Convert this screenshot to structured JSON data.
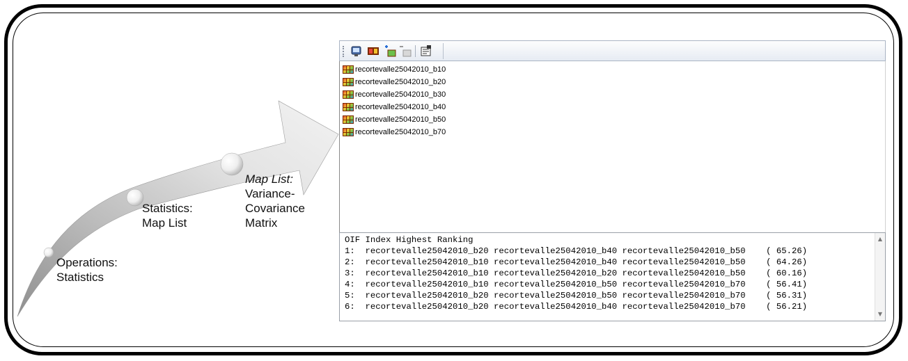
{
  "steps": [
    {
      "line1": "Operations:",
      "line2": "Statistics"
    },
    {
      "line1": "Statistics:",
      "line2": "Map List"
    },
    {
      "line1_italic": "Map List:",
      "line2": "Variance-",
      "line3": "Covariance",
      "line4": "Matrix"
    }
  ],
  "toolbar": {
    "buttons": [
      "display-icon",
      "film-strip-icon",
      "new-map-icon",
      "delete-map-icon",
      "properties-icon"
    ]
  },
  "maplist": {
    "items": [
      "recortevalle25042010_b10",
      "recortevalle25042010_b20",
      "recortevalle25042010_b30",
      "recortevalle25042010_b40",
      "recortevalle25042010_b50",
      "recortevalle25042010_b70"
    ]
  },
  "output": {
    "header": "OIF Index Highest Ranking",
    "rows": [
      "1:  recortevalle25042010_b20 recortevalle25042010_b40 recortevalle25042010_b50    ( 65.26)",
      "2:  recortevalle25042010_b10 recortevalle25042010_b40 recortevalle25042010_b50    ( 64.26)",
      "3:  recortevalle25042010_b10 recortevalle25042010_b20 recortevalle25042010_b50    ( 60.16)",
      "4:  recortevalle25042010_b10 recortevalle25042010_b50 recortevalle25042010_b70    ( 56.41)",
      "5:  recortevalle25042010_b20 recortevalle25042010_b50 recortevalle25042010_b70    ( 56.31)",
      "6:  recortevalle25042010_b20 recortevalle25042010_b40 recortevalle25042010_b70    ( 56.21)"
    ]
  },
  "colors": {
    "frame": "#000000",
    "arrow_light": "#f4f4f4",
    "arrow_dark": "#a9a9a9",
    "toolbar_border": "#aab4c4"
  }
}
